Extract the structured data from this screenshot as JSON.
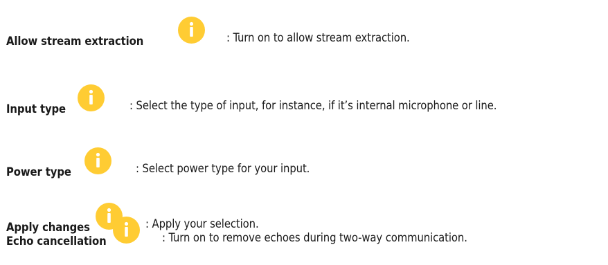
{
  "items": [
    {
      "label": "Allow stream extraction",
      "icon": "info-icon",
      "description": ": Turn on to allow stream extraction."
    },
    {
      "label": "Input type",
      "icon": "info-icon",
      "description": ": Select the type of input, for instance, if it’s internal microphone or line."
    },
    {
      "label": "Power type",
      "icon": "info-icon",
      "description": ": Select power type for your input."
    },
    {
      "label": "Apply changes",
      "icon": "info-icon",
      "description": ": Apply your selection."
    },
    {
      "label": "Echo cancellation",
      "icon": "info-icon",
      "description": ": Turn on to remove echoes during two-way communication."
    }
  ],
  "colors": {
    "icon_fill": "#FFCC33",
    "icon_glyph": "#ffffff",
    "text": "#1a1a1a"
  }
}
